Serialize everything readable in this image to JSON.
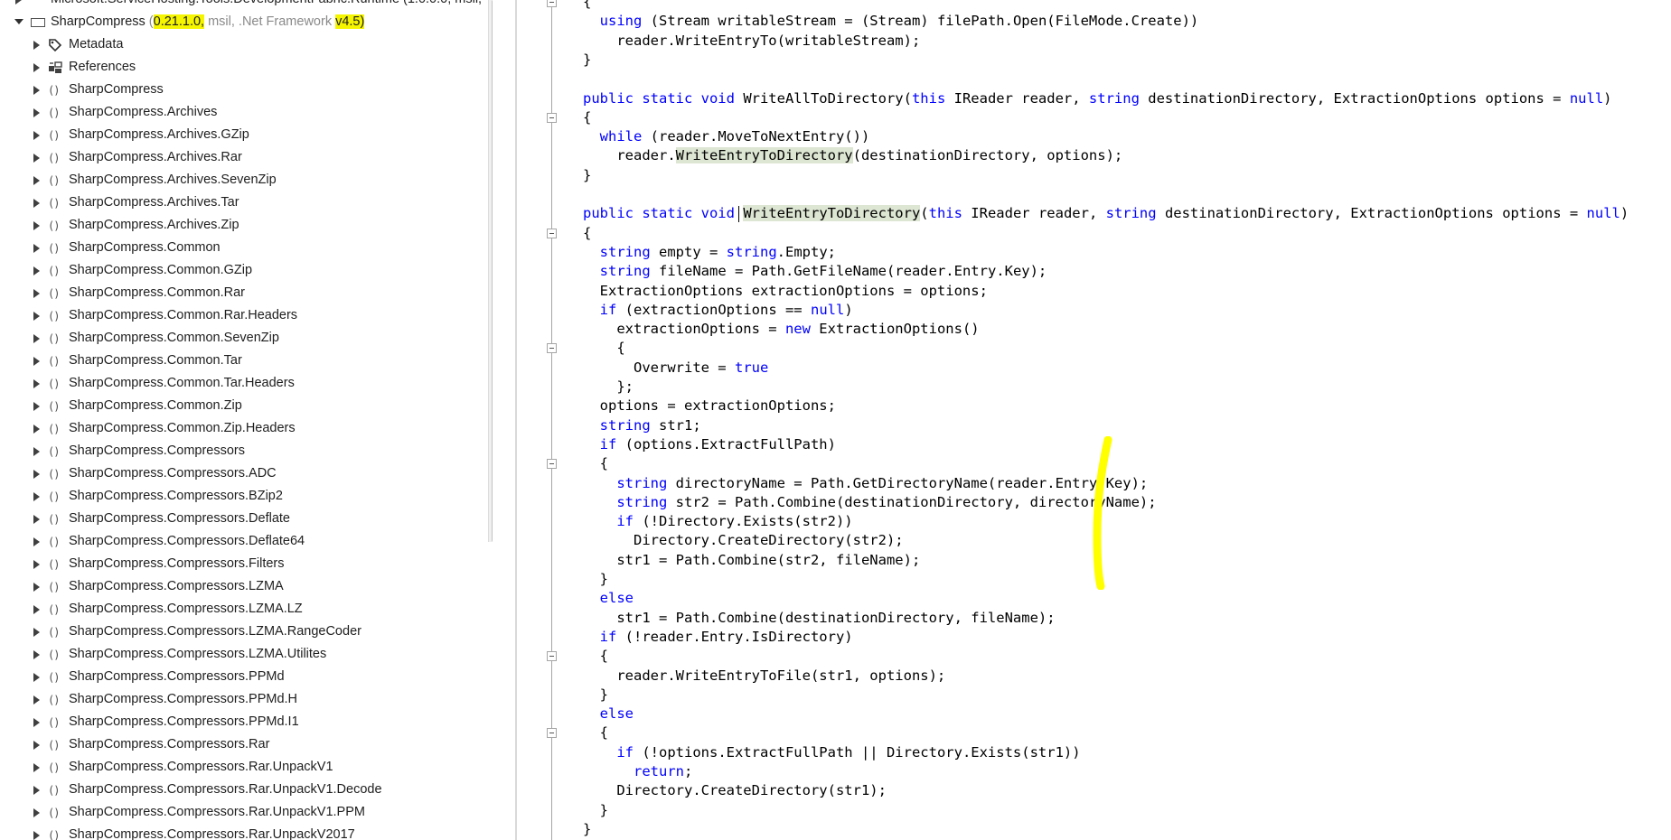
{
  "tree": {
    "top_partial": "Microsoft.ServiceHosting.Tools.DevelopmentFabric.Runtime (1.0.0.0, msil,",
    "assembly": {
      "name": "SharpCompress",
      "version": "0.21.1.0,",
      "arch": " msil, .Net Framework ",
      "framework_version": "v4.5)",
      "version_open": "(",
      "version_close": ""
    },
    "items": [
      {
        "label": "Metadata",
        "icon": "metadata-icon"
      },
      {
        "label": "References",
        "icon": "references-icon"
      },
      {
        "label": "SharpCompress",
        "icon": "namespace-icon"
      },
      {
        "label": "SharpCompress.Archives",
        "icon": "namespace-icon"
      },
      {
        "label": "SharpCompress.Archives.GZip",
        "icon": "namespace-icon"
      },
      {
        "label": "SharpCompress.Archives.Rar",
        "icon": "namespace-icon"
      },
      {
        "label": "SharpCompress.Archives.SevenZip",
        "icon": "namespace-icon"
      },
      {
        "label": "SharpCompress.Archives.Tar",
        "icon": "namespace-icon"
      },
      {
        "label": "SharpCompress.Archives.Zip",
        "icon": "namespace-icon"
      },
      {
        "label": "SharpCompress.Common",
        "icon": "namespace-icon"
      },
      {
        "label": "SharpCompress.Common.GZip",
        "icon": "namespace-icon"
      },
      {
        "label": "SharpCompress.Common.Rar",
        "icon": "namespace-icon"
      },
      {
        "label": "SharpCompress.Common.Rar.Headers",
        "icon": "namespace-icon"
      },
      {
        "label": "SharpCompress.Common.SevenZip",
        "icon": "namespace-icon"
      },
      {
        "label": "SharpCompress.Common.Tar",
        "icon": "namespace-icon"
      },
      {
        "label": "SharpCompress.Common.Tar.Headers",
        "icon": "namespace-icon"
      },
      {
        "label": "SharpCompress.Common.Zip",
        "icon": "namespace-icon"
      },
      {
        "label": "SharpCompress.Common.Zip.Headers",
        "icon": "namespace-icon"
      },
      {
        "label": "SharpCompress.Compressors",
        "icon": "namespace-icon"
      },
      {
        "label": "SharpCompress.Compressors.ADC",
        "icon": "namespace-icon"
      },
      {
        "label": "SharpCompress.Compressors.BZip2",
        "icon": "namespace-icon"
      },
      {
        "label": "SharpCompress.Compressors.Deflate",
        "icon": "namespace-icon"
      },
      {
        "label": "SharpCompress.Compressors.Deflate64",
        "icon": "namespace-icon"
      },
      {
        "label": "SharpCompress.Compressors.Filters",
        "icon": "namespace-icon"
      },
      {
        "label": "SharpCompress.Compressors.LZMA",
        "icon": "namespace-icon"
      },
      {
        "label": "SharpCompress.Compressors.LZMA.LZ",
        "icon": "namespace-icon"
      },
      {
        "label": "SharpCompress.Compressors.LZMA.RangeCoder",
        "icon": "namespace-icon"
      },
      {
        "label": "SharpCompress.Compressors.LZMA.Utilites",
        "icon": "namespace-icon"
      },
      {
        "label": "SharpCompress.Compressors.PPMd",
        "icon": "namespace-icon"
      },
      {
        "label": "SharpCompress.Compressors.PPMd.H",
        "icon": "namespace-icon"
      },
      {
        "label": "SharpCompress.Compressors.PPMd.I1",
        "icon": "namespace-icon"
      },
      {
        "label": "SharpCompress.Compressors.Rar",
        "icon": "namespace-icon"
      },
      {
        "label": "SharpCompress.Compressors.Rar.UnpackV1",
        "icon": "namespace-icon"
      },
      {
        "label": "SharpCompress.Compressors.Rar.UnpackV1.Decode",
        "icon": "namespace-icon"
      },
      {
        "label": "SharpCompress.Compressors.Rar.UnpackV1.PPM",
        "icon": "namespace-icon"
      },
      {
        "label": "SharpCompress.Compressors.Rar.UnpackV2017",
        "icon": "namespace-icon"
      }
    ]
  },
  "code": {
    "lines": [
      [
        {
          "t": "{"
        }
      ],
      [
        {
          "t": "  "
        },
        {
          "t": "using",
          "k": 1
        },
        {
          "t": " (Stream writableStream = (Stream) filePath.Open(FileMode.Create))"
        }
      ],
      [
        {
          "t": "    reader.WriteEntryTo(writableStream);"
        }
      ],
      [
        {
          "t": "}"
        }
      ],
      [],
      [
        {
          "t": "public static void",
          "k": 1
        },
        {
          "t": " WriteAllToDirectory("
        },
        {
          "t": "this",
          "k": 1
        },
        {
          "t": " IReader reader, "
        },
        {
          "t": "string",
          "k": 1
        },
        {
          "t": " destinationDirectory, ExtractionOptions options = "
        },
        {
          "t": "null",
          "k": 1
        },
        {
          "t": ")"
        }
      ],
      [
        {
          "t": "{"
        }
      ],
      [
        {
          "t": "  "
        },
        {
          "t": "while",
          "k": 1
        },
        {
          "t": " (reader.MoveToNextEntry())"
        }
      ],
      [
        {
          "t": "    reader."
        },
        {
          "t": "WriteEntryToDirectory",
          "h": 1
        },
        {
          "t": "(destinationDirectory, options);"
        }
      ],
      [
        {
          "t": "}"
        }
      ],
      [],
      [
        {
          "t": "public static void",
          "k": 1
        },
        {
          "t": " "
        },
        {
          "t": "WriteEntryToDirectory",
          "h": 1
        },
        {
          "t": "("
        },
        {
          "t": "this",
          "k": 1
        },
        {
          "t": " IReader reader, "
        },
        {
          "t": "string",
          "k": 1
        },
        {
          "t": " destinationDirectory, ExtractionOptions options = "
        },
        {
          "t": "null",
          "k": 1
        },
        {
          "t": ")"
        }
      ],
      [
        {
          "t": "{"
        }
      ],
      [
        {
          "t": "  "
        },
        {
          "t": "string",
          "k": 1
        },
        {
          "t": " empty = "
        },
        {
          "t": "string",
          "k": 1
        },
        {
          "t": ".Empty;"
        }
      ],
      [
        {
          "t": "  "
        },
        {
          "t": "string",
          "k": 1
        },
        {
          "t": " fileName = Path.GetFileName(reader.Entry.Key);"
        }
      ],
      [
        {
          "t": "  ExtractionOptions extractionOptions = options;"
        }
      ],
      [
        {
          "t": "  "
        },
        {
          "t": "if",
          "k": 1
        },
        {
          "t": " (extractionOptions == "
        },
        {
          "t": "null",
          "k": 1
        },
        {
          "t": ")"
        }
      ],
      [
        {
          "t": "    extractionOptions = "
        },
        {
          "t": "new",
          "k": 1
        },
        {
          "t": " ExtractionOptions()"
        }
      ],
      [
        {
          "t": "    {"
        }
      ],
      [
        {
          "t": "      Overwrite = "
        },
        {
          "t": "true",
          "k": 1
        }
      ],
      [
        {
          "t": "    };"
        }
      ],
      [
        {
          "t": "  options = extractionOptions;"
        }
      ],
      [
        {
          "t": "  "
        },
        {
          "t": "string",
          "k": 1
        },
        {
          "t": " str1;"
        }
      ],
      [
        {
          "t": "  "
        },
        {
          "t": "if",
          "k": 1
        },
        {
          "t": " (options.ExtractFullPath)"
        }
      ],
      [
        {
          "t": "  {"
        }
      ],
      [
        {
          "t": "    "
        },
        {
          "t": "string",
          "k": 1
        },
        {
          "t": " directoryName = Path.GetDirectoryName(reader.Entry.Key);"
        }
      ],
      [
        {
          "t": "    "
        },
        {
          "t": "string",
          "k": 1
        },
        {
          "t": " str2 = Path.Combine(destinationDirectory, directoryName);"
        }
      ],
      [
        {
          "t": "    "
        },
        {
          "t": "if",
          "k": 1
        },
        {
          "t": " (!Directory.Exists(str2))"
        }
      ],
      [
        {
          "t": "      Directory.CreateDirectory(str2);"
        }
      ],
      [
        {
          "t": "    str1 = Path.Combine(str2, fileName);"
        }
      ],
      [
        {
          "t": "  }"
        }
      ],
      [
        {
          "t": "  "
        },
        {
          "t": "else",
          "k": 1
        }
      ],
      [
        {
          "t": "    str1 = Path.Combine(destinationDirectory, fileName);"
        }
      ],
      [
        {
          "t": "  "
        },
        {
          "t": "if",
          "k": 1
        },
        {
          "t": " (!reader.Entry.IsDirectory)"
        }
      ],
      [
        {
          "t": "  {"
        }
      ],
      [
        {
          "t": "    reader.WriteEntryToFile(str1, options);"
        }
      ],
      [
        {
          "t": "  }"
        }
      ],
      [
        {
          "t": "  "
        },
        {
          "t": "else",
          "k": 1
        }
      ],
      [
        {
          "t": "  {"
        }
      ],
      [
        {
          "t": "    "
        },
        {
          "t": "if",
          "k": 1
        },
        {
          "t": " (!options.ExtractFullPath || Directory.Exists(str1))"
        }
      ],
      [
        {
          "t": "      "
        },
        {
          "t": "return",
          "k": 1
        },
        {
          "t": ";"
        }
      ],
      [
        {
          "t": "    Directory.CreateDirectory(str1);"
        }
      ],
      [
        {
          "t": "  }"
        }
      ],
      [
        {
          "t": "}"
        }
      ]
    ]
  },
  "colors": {
    "keyword": "#0000ff",
    "highlight_yellow": "#f5f500",
    "reference_highlight": "#dde6d3",
    "annotation_mark": "#ffff00"
  }
}
